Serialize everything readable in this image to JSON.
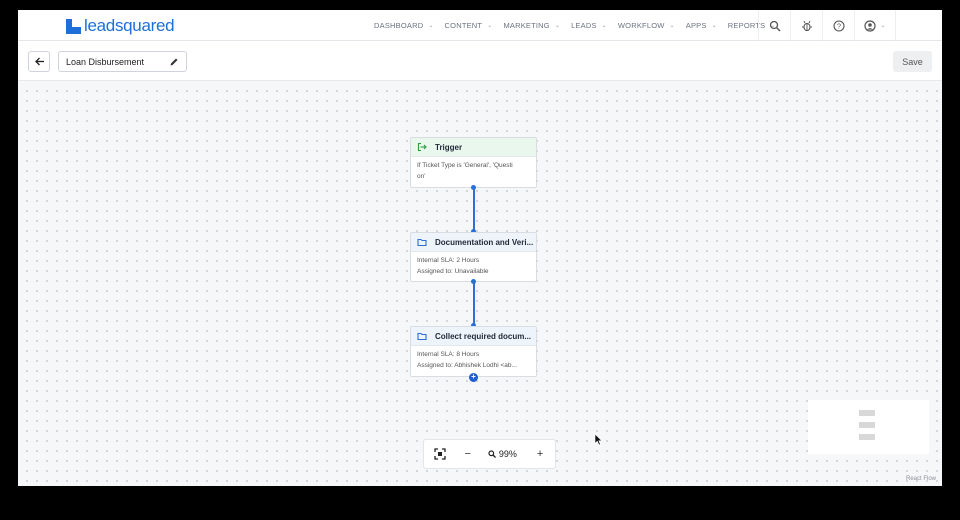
{
  "brand": {
    "logo_text_a": "lead",
    "logo_text_b": "squared",
    "color": "#1e6fd8"
  },
  "nav": {
    "items": [
      {
        "label": "DASHBOARD"
      },
      {
        "label": "CONTENT"
      },
      {
        "label": "MARKETING"
      },
      {
        "label": "LEADS"
      },
      {
        "label": "WORKFLOW"
      },
      {
        "label": "APPS"
      },
      {
        "label": "REPORTS"
      }
    ],
    "icons": [
      "search-icon",
      "bug-icon",
      "help-icon",
      "user-icon"
    ]
  },
  "header": {
    "title": "Loan Disbursement",
    "save_label": "Save"
  },
  "flow": {
    "trigger": {
      "title": "Trigger",
      "line1": "If Ticket Type is 'General', 'Questi",
      "line2": "on'"
    },
    "doc": {
      "title": "Documentation and Veri...",
      "sla": "Internal SLA: 2 Hours",
      "assigned": "Assigned to: Unavailable"
    },
    "collect": {
      "title": "Collect required docum...",
      "sla": "Internal SLA: 8 Hours",
      "assigned": "Assigned to: Abhishek Lodhi <ab..."
    },
    "accent": "#2c6fd6"
  },
  "zoom": {
    "value": "99%",
    "minus": "−",
    "plus": "+"
  },
  "attribution": "React Flow"
}
